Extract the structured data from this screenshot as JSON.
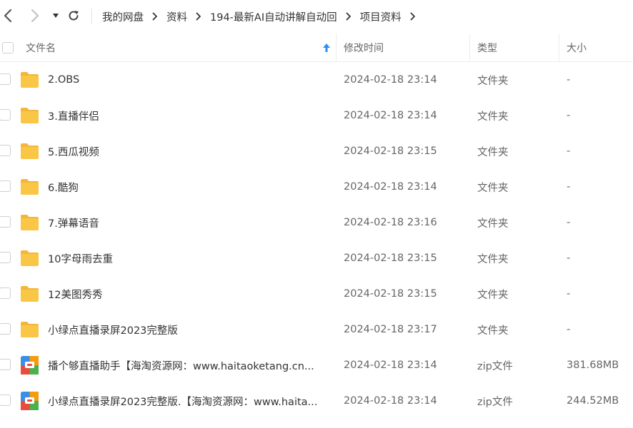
{
  "nav": {
    "back_icon": "chevron-left-icon",
    "forward_icon": "chevron-right-icon",
    "dropdown_icon": "caret-down-icon",
    "refresh_icon": "refresh-icon"
  },
  "breadcrumb": [
    "我的网盘",
    "资料",
    "194-最新AI自动讲解自动回",
    "项目资料"
  ],
  "header": {
    "name": "文件名",
    "mtime": "修改时间",
    "type": "类型",
    "size": "大小",
    "sort_icon": "arrow-up-icon"
  },
  "files": [
    {
      "name": "2.OBS",
      "mtime": "2024-02-18 23:14",
      "type": "文件夹",
      "size": "-",
      "icon": "folder-icon"
    },
    {
      "name": "3.直播伴侣",
      "mtime": "2024-02-18 23:14",
      "type": "文件夹",
      "size": "-",
      "icon": "folder-icon"
    },
    {
      "name": "5.西瓜视频",
      "mtime": "2024-02-18 23:15",
      "type": "文件夹",
      "size": "-",
      "icon": "folder-icon"
    },
    {
      "name": "6.酷狗",
      "mtime": "2024-02-18 23:14",
      "type": "文件夹",
      "size": "-",
      "icon": "folder-icon"
    },
    {
      "name": "7.弹幕语音",
      "mtime": "2024-02-18 23:16",
      "type": "文件夹",
      "size": "-",
      "icon": "folder-icon"
    },
    {
      "name": "10字母雨去重",
      "mtime": "2024-02-18 23:15",
      "type": "文件夹",
      "size": "-",
      "icon": "folder-icon"
    },
    {
      "name": "12美图秀秀",
      "mtime": "2024-02-18 23:15",
      "type": "文件夹",
      "size": "-",
      "icon": "folder-icon"
    },
    {
      "name": "小绿点直播录屏2023完整版",
      "mtime": "2024-02-18 23:17",
      "type": "文件夹",
      "size": "-",
      "icon": "folder-icon"
    },
    {
      "name": "播个够直播助手【海淘资源网：www.haitaoketang.cn...",
      "mtime": "2024-02-18 23:14",
      "type": "zip文件",
      "size": "381.68MB",
      "icon": "zip-archive-icon"
    },
    {
      "name": "小绿点直播录屏2023完整版.【海淘资源网：www.haita...",
      "mtime": "2024-02-18 23:14",
      "type": "zip文件",
      "size": "244.52MB",
      "icon": "zip-archive-icon"
    }
  ],
  "colors": {
    "folder": "#f9c645",
    "folder_tab": "#f4b63a",
    "accent_blue": "#2e8bf0",
    "zip_green": "#4caf50",
    "zip_orange": "#f39c12",
    "zip_red": "#e74c3c",
    "zip_blue": "#3b8ee8"
  }
}
